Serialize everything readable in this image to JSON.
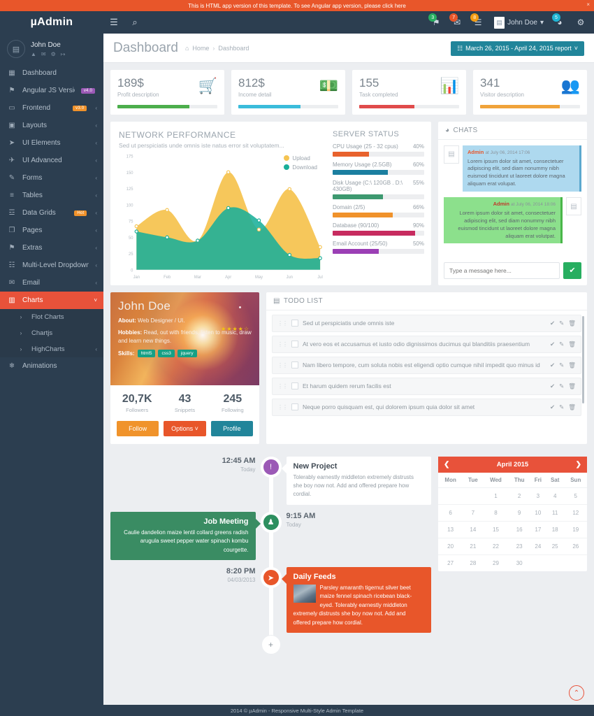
{
  "promo": {
    "text": "This is HTML app version of this template. To see Angular app version, please click here",
    "close": "×"
  },
  "navbar": {
    "brand": "µAdmin",
    "menu_icon": "☰",
    "search_icon": "⌕",
    "icons": [
      {
        "name": "bell-icon",
        "glyph": "⚑",
        "badge": "3",
        "color": "#27ae60"
      },
      {
        "name": "envelope-icon",
        "glyph": "✉",
        "badge": "7",
        "color": "#e8562a"
      },
      {
        "name": "tasks-icon",
        "glyph": "☰",
        "badge": "8",
        "color": "#f39c12"
      }
    ],
    "user": {
      "label": "John Doe",
      "caret": "▾",
      "avatar": "▤"
    },
    "chat": {
      "glyph": "◕",
      "badge": "5"
    },
    "settings": {
      "glyph": "⚙"
    }
  },
  "sidebar": {
    "user": {
      "name": "John Doe",
      "icons": [
        "▲",
        "✉",
        "⚙",
        "↦"
      ]
    },
    "items": [
      {
        "label": "Dashboard",
        "icon": "▦",
        "tag": null,
        "caret": false,
        "active": false
      },
      {
        "label": "Angular JS Version",
        "icon": "⚑",
        "tag": "v4.0",
        "tag_color": "purple",
        "caret": false,
        "active": false
      },
      {
        "label": "Frontend",
        "icon": "▭",
        "tag": "v3.0",
        "tag_color": "orange",
        "caret": true,
        "active": false
      },
      {
        "label": "Layouts",
        "icon": "▣",
        "tag": null,
        "caret": true,
        "active": false
      },
      {
        "label": "UI Elements",
        "icon": "➤",
        "tag": null,
        "caret": true,
        "active": false
      },
      {
        "label": "UI Advanced",
        "icon": "✈",
        "tag": null,
        "caret": true,
        "active": false
      },
      {
        "label": "Forms",
        "icon": "✎",
        "tag": null,
        "caret": true,
        "active": false
      },
      {
        "label": "Tables",
        "icon": "≡",
        "tag": null,
        "caret": true,
        "active": false
      },
      {
        "label": "Data Grids",
        "icon": "☲",
        "tag": "Hot",
        "tag_color": "orange",
        "caret": true,
        "active": false
      },
      {
        "label": "Pages",
        "icon": "❐",
        "tag": null,
        "caret": true,
        "active": false
      },
      {
        "label": "Extras",
        "icon": "⚑",
        "tag": null,
        "caret": true,
        "active": false
      },
      {
        "label": "Multi-Level Dropdown",
        "icon": "☷",
        "tag": null,
        "caret": true,
        "active": false
      },
      {
        "label": "Email",
        "icon": "✉",
        "tag": null,
        "caret": true,
        "active": false
      },
      {
        "label": "Charts",
        "icon": "▥",
        "tag": null,
        "caret": true,
        "active": true
      },
      {
        "label": "Animations",
        "icon": "❄",
        "tag": null,
        "caret": false,
        "active": false
      }
    ],
    "charts_submenu": [
      {
        "label": "Flot Charts",
        "caret": false
      },
      {
        "label": "Chartjs",
        "caret": false
      },
      {
        "label": "HighCharts",
        "caret": true
      }
    ]
  },
  "page": {
    "title": "Dashboard",
    "breadcrumb": [
      "Home",
      "Dashboard"
    ],
    "home_icon": "⌂",
    "separator": "›",
    "date_range": "March 26, 2015 - April 24, 2015 report",
    "date_icon": "☷",
    "date_caret": "˅"
  },
  "stats": [
    {
      "value": "189$",
      "desc": "Profit description",
      "icon": "🛒",
      "color": "#4cae4c",
      "progress": 72
    },
    {
      "value": "812$",
      "desc": "Income detail",
      "icon": "💵",
      "color": "#3bbcdb",
      "progress": 62
    },
    {
      "value": "155",
      "desc": "Task completed",
      "icon": "📊",
      "color": "#e04b4b",
      "progress": 55
    },
    {
      "value": "341",
      "desc": "Visitor description",
      "icon": "👥",
      "color": "#f0a33a",
      "progress": 80
    }
  ],
  "network": {
    "title": "NETWORK PERFORMANCE",
    "subtitle": "Sed ut perspiciatis unde omnis iste natus error sit voluptatem..."
  },
  "chart_data": {
    "type": "area",
    "title": "NETWORK PERFORMANCE",
    "subtitle": "Sed ut perspiciatis unde omnis iste natus error sit voluptatem...",
    "categories": [
      "Jan",
      "Feb",
      "Mar",
      "Apr",
      "May",
      "Jun",
      "Jul"
    ],
    "series": [
      {
        "name": "Upload",
        "color": "#f5c452",
        "values": [
          67,
          92,
          45,
          150,
          62,
          124,
          35
        ]
      },
      {
        "name": "Download",
        "color": "#1aaf9a",
        "values": [
          59,
          50,
          45,
          95,
          76,
          23,
          18
        ]
      }
    ],
    "xlabel": "",
    "ylabel": "",
    "ylim": [
      0,
      175
    ],
    "yticks": [
      0,
      25,
      50,
      75,
      100,
      125,
      150,
      175
    ],
    "grid": false,
    "legend_position": "top-right"
  },
  "server_status": {
    "title": "SERVER STATUS",
    "items": [
      {
        "label": "CPU Usage (25 - 32 cpus)",
        "pct": "40%",
        "value": 40,
        "color": "#e8622d"
      },
      {
        "label": "Memory Usage (2.5GB)",
        "pct": "60%",
        "value": 60,
        "color": "#1b7fa0"
      },
      {
        "label": "Disk Usage (C:\\ 120GB . D:\\ 430GB)",
        "pct": "55%",
        "value": 55,
        "color": "#3d9970"
      },
      {
        "label": "Domain (2/5)",
        "pct": "66%",
        "value": 66,
        "color": "#f0922b"
      },
      {
        "label": "Database (90/100)",
        "pct": "90%",
        "value": 90,
        "color": "#c72b5f"
      },
      {
        "label": "Email Account (25/50)",
        "pct": "50%",
        "value": 50,
        "color": "#9b3fb5"
      }
    ]
  },
  "chats": {
    "title": "CHATS",
    "icon": "◕",
    "messages": [
      {
        "who": "Admin",
        "when": "at July 06, 2014 17:06",
        "text": "Lorem ipsum dolor sit amet, consectetuer adipiscing elit, sed diam nonummy nibh euismod tincidunt ut laoreet dolore magna aliquam erat volupat.",
        "side": "left"
      },
      {
        "who": "Admin",
        "when": "at July 06, 2014 18:06",
        "text": "Lorem ipsum dolor sit amet, consectetuer adipiscing elit, sed diam nonummy nibh euismod tincidunt ut laoreet dolore magna aliquam erat volutpat.",
        "side": "right"
      }
    ],
    "input_placeholder": "Type a message here...",
    "send_icon": "✔"
  },
  "profile": {
    "name": "John Doe",
    "about_label": "About:",
    "about": "Web Designer / UI.",
    "hobbies_label": "Hobbies:",
    "hobbies": "Read, out with friends, listen to music, draw and learn new things.",
    "skills_label": "Skills:",
    "skills": [
      "html5",
      "css3",
      "jquery"
    ],
    "stars": "★★★★☆",
    "stats": [
      {
        "n": "20,7K",
        "l": "Followers"
      },
      {
        "n": "43",
        "l": "Snippets"
      },
      {
        "n": "245",
        "l": "Following"
      }
    ],
    "buttons": [
      {
        "label": "Follow",
        "style": "bt-o"
      },
      {
        "label": "Options ˅",
        "style": "bt-r"
      },
      {
        "label": "Profile",
        "style": "bt-b"
      }
    ]
  },
  "todo": {
    "title": "TODO LIST",
    "icon": "▤",
    "actions": {
      "check": "✔",
      "edit": "✎",
      "delete": "🗑"
    },
    "items": [
      "Sed ut perspiciatis unde omnis iste",
      "At vero eos et accusamus et iusto odio dignissimos ducimus qui blanditiis praesentium",
      "Nam libero tempore, cum soluta nobis est eligendi optio cumque nihil impedit quo minus id",
      "Et harum quidem rerum facilis est",
      "Neque porro quisquam est, qui dolorem ipsum quia dolor sit amet"
    ]
  },
  "timeline": {
    "plus_icon": "+",
    "items": [
      {
        "time": "12:45 AM",
        "date": "Today",
        "icon": "!",
        "icon_class": "ti-purple",
        "card_side": "right",
        "card_class": "tc-white",
        "title": "New Project",
        "text": "Tolerably earnestly middleton extremely distrusts she boy now not. Add and offered prepare how cordial.",
        "thumb": false
      },
      {
        "time": "9:15 AM",
        "date": "Today",
        "icon": "♟",
        "icon_class": "ti-green",
        "card_side": "left",
        "card_class": "tc-green",
        "title": "Job Meeting",
        "text": "Caulie dandelion maize lentil collard greens radish arugula sweet pepper water spinach kombu courgette.",
        "thumb": false
      },
      {
        "time": "8:20 PM",
        "date": "04/03/2013",
        "icon": "➤",
        "icon_class": "ti-orange",
        "card_side": "right",
        "card_class": "tc-orange",
        "title": "Daily Feeds",
        "text": "Parsley amaranth tigernut silver beet maize fennel spinach ricebean black-eyed. Tolerably earnestly middleton extremely distrusts she boy now not. Add and offered prepare how cordial.",
        "thumb": true
      }
    ]
  },
  "calendar": {
    "month": "April 2015",
    "prev": "❮",
    "next": "❯",
    "days": [
      "Mon",
      "Tue",
      "Wed",
      "Thu",
      "Fri",
      "Sat",
      "Sun"
    ],
    "weeks": [
      [
        "",
        "",
        "1",
        "2",
        "3",
        "4",
        "5"
      ],
      [
        "6",
        "7",
        "8",
        "9",
        "10",
        "11",
        "12"
      ],
      [
        "13",
        "14",
        "15",
        "16",
        "17",
        "18",
        "19"
      ],
      [
        "20",
        "21",
        "22",
        "23",
        "24",
        "25",
        "26"
      ],
      [
        "27",
        "28",
        "29",
        "30",
        "",
        "",
        ""
      ]
    ]
  },
  "footer": {
    "text": "2014 © µAdmin - Responsive Multi-Style Admin Template",
    "gotop": "⌃"
  }
}
